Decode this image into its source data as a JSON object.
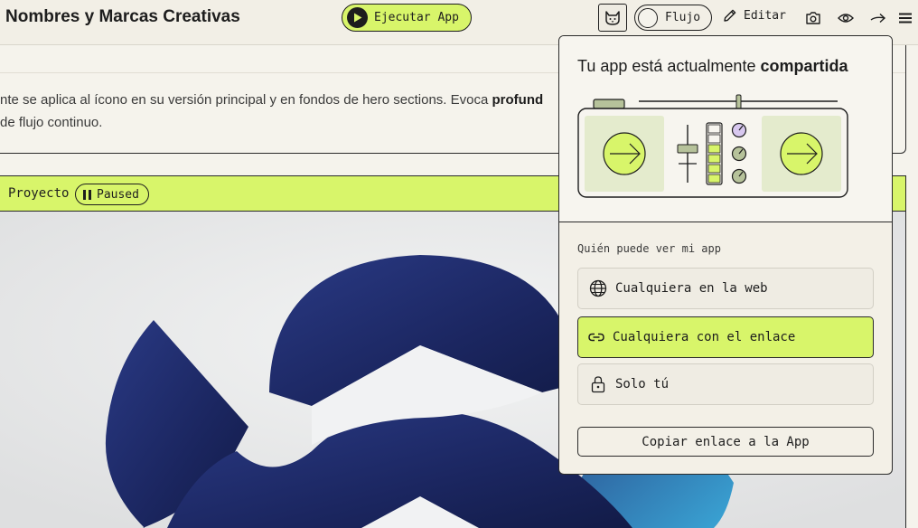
{
  "header": {
    "title": "Nombres y Marcas Creativas",
    "run_label": "Ejecutar App",
    "flow_label": "Flujo",
    "edit_label": "Editar"
  },
  "content": {
    "desc_line1_pre": "nte se aplica al ícono en su versión principal y en fondos de hero sections. Evoca ",
    "desc_line1_bold": "profund",
    "desc_line2": "de flujo continuo."
  },
  "project": {
    "label": "Proyecto",
    "status": "Paused"
  },
  "share": {
    "title_pre": "Tu app está actualmente ",
    "title_bold": "compartida",
    "section_label": "Quién puede ver mi app",
    "options": [
      {
        "label": "Cualquiera en la web",
        "icon": "globe-icon",
        "selected": false
      },
      {
        "label": "Cualquiera con el enlace",
        "icon": "link-icon",
        "selected": true
      },
      {
        "label": "Solo tú",
        "icon": "lock-icon",
        "selected": false
      }
    ],
    "copy_label": "Copiar enlace a la App"
  },
  "colors": {
    "accent": "#d8f56a",
    "dark": "#1d1d1d",
    "logo_blue": "#1e2a6b"
  }
}
